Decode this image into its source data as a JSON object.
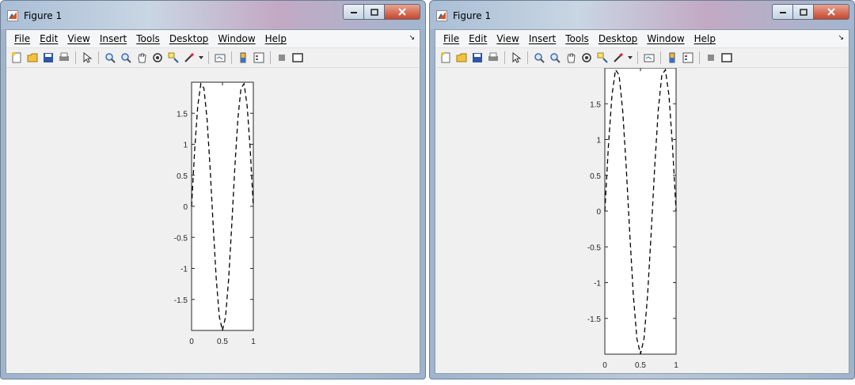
{
  "windows": [
    {
      "title": "Figure 1",
      "menus": [
        "File",
        "Edit",
        "View",
        "Insert",
        "Tools",
        "Desktop",
        "Window",
        "Help"
      ],
      "menu_overflow": "↘",
      "toolbar": [
        "new-figure-icon",
        "open-file-icon",
        "save-icon",
        "print-icon",
        "pointer-icon",
        "zoom-in-icon",
        "zoom-out-icon",
        "pan-icon",
        "rotate-3d-icon",
        "data-cursor-icon",
        "brush-icon",
        "linked-plot-icon",
        "insert-colorbar-icon",
        "insert-legend-icon",
        "hide-plot-tools-icon",
        "show-plot-tools-icon"
      ],
      "chart_data": {
        "type": "line",
        "line_style": "dashed",
        "color": "#000000",
        "function": "2*sin(3*pi*x)",
        "x": [
          0,
          0.05,
          0.1,
          0.15,
          0.2,
          0.25,
          0.3,
          0.35,
          0.4,
          0.45,
          0.5,
          0.55,
          0.6,
          0.65,
          0.7,
          0.75,
          0.8,
          0.85,
          0.9,
          0.95,
          1
        ],
        "y": [
          0,
          0.908,
          1.618,
          1.975,
          1.902,
          1.414,
          0.618,
          -0.313,
          -1.176,
          -1.782,
          -2.0,
          -1.782,
          -1.176,
          -0.313,
          0.618,
          1.414,
          1.902,
          1.975,
          1.618,
          0.908,
          0
        ],
        "xlim": [
          0,
          1
        ],
        "ylim": [
          -2,
          2
        ],
        "xticks": [
          "0",
          "0.5",
          "1"
        ],
        "yticks": [
          "-1.5",
          "-1",
          "-0.5",
          "0",
          "0.5",
          "1",
          "1.5"
        ]
      }
    },
    {
      "title": "Figure 1",
      "menus": [
        "File",
        "Edit",
        "View",
        "Insert",
        "Tools",
        "Desktop",
        "Window",
        "Help"
      ],
      "menu_overflow": "↘",
      "toolbar": [
        "new-figure-icon",
        "open-file-icon",
        "save-icon",
        "print-icon",
        "pointer-icon",
        "zoom-in-icon",
        "zoom-out-icon",
        "pan-icon",
        "rotate-3d-icon",
        "data-cursor-icon",
        "brush-icon",
        "linked-plot-icon",
        "insert-colorbar-icon",
        "insert-legend-icon",
        "hide-plot-tools-icon",
        "show-plot-tools-icon"
      ],
      "chart_data": {
        "type": "line",
        "line_style": "dashed",
        "color": "#000000",
        "function": "2*sin(3*pi*x)",
        "x": [
          0,
          0.05,
          0.1,
          0.15,
          0.2,
          0.25,
          0.3,
          0.35,
          0.4,
          0.45,
          0.5,
          0.55,
          0.6,
          0.65,
          0.7,
          0.75,
          0.8,
          0.85,
          0.9,
          0.95,
          1
        ],
        "y": [
          0,
          0.908,
          1.618,
          1.975,
          1.902,
          1.414,
          0.618,
          -0.313,
          -1.176,
          -1.782,
          -2.0,
          -1.782,
          -1.176,
          -0.313,
          0.618,
          1.414,
          1.902,
          1.975,
          1.618,
          0.908,
          0
        ],
        "xlim": [
          0,
          1
        ],
        "ylim": [
          -2,
          2
        ],
        "xticks": [
          "0",
          "0.5",
          "1"
        ],
        "yticks": [
          "-1.5",
          "-1",
          "-0.5",
          "0",
          "0.5",
          "1",
          "1.5"
        ]
      }
    }
  ]
}
